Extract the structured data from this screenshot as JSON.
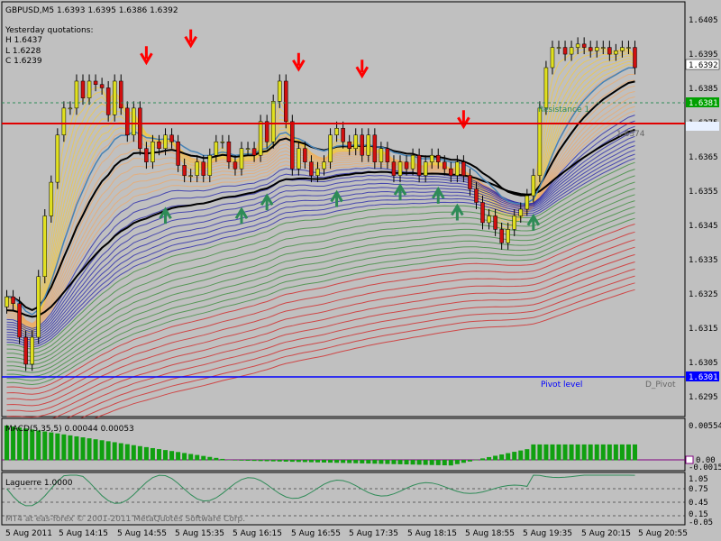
{
  "header": {
    "symbol_line": "GBPUSD,M5  1.6393 1.6395 1.6386 1.6392",
    "yesterday_title": "Yesterday quotations:",
    "high": "H 1.6437",
    "low": "L 1.6228",
    "close": "C 1.6239"
  },
  "price_axis": {
    "ticks": [
      "1.6405",
      "1.6395",
      "1.6385",
      "1.6375",
      "1.6365",
      "1.6355",
      "1.6345",
      "1.6335",
      "1.6325",
      "1.6315",
      "1.6305",
      "1.6295"
    ],
    "badges": {
      "current": "1.6392",
      "green_level": "1.6381",
      "pivot": "1.6301"
    }
  },
  "levels": {
    "resistance_label": "Resistance 1",
    "resistance_value_text": "1.6374",
    "pivot_label": "Pivot level",
    "d_pivot_label": "D_Pivot"
  },
  "time_axis": [
    "5 Aug 2011",
    "5 Aug 14:15",
    "5 Aug 14:55",
    "5 Aug 15:35",
    "5 Aug 16:15",
    "5 Aug 16:55",
    "5 Aug 17:35",
    "5 Aug 18:15",
    "5 Aug 18:55",
    "5 Aug 19:35",
    "5 Aug 20:15",
    "5 Aug 20:55"
  ],
  "macd_panel": {
    "label": "MACD(5,35,5) 0.00044 0.00053",
    "axis": [
      "0.00554",
      "0.00",
      "-0.00158"
    ]
  },
  "laguerre_panel": {
    "label": "Laguerre 1.0000",
    "axis": [
      "1.05",
      "0.75",
      "0.45",
      "0.15",
      "-0.05"
    ]
  },
  "watermark": "MT4 at eas-forex © 2001-2011 MetaQuotes Software Corp.",
  "colors": {
    "background": "#c0c0c0",
    "bull_candle": "#e0e020",
    "bear_candle": "#d01010",
    "sell_arrow": "#ff0000",
    "buy_arrow": "#2e8b57",
    "resistance_line": "#e00000",
    "pivot_line": "#0000ff",
    "macd_hist": "#10a010",
    "laguerre_line": "#2e8b57"
  },
  "chart_data": {
    "type": "candlestick",
    "title": "GBPUSD,M5",
    "ylim": [
      1.6289,
      1.6411
    ],
    "y_ticks": [
      1.6405,
      1.6395,
      1.6385,
      1.6375,
      1.6365,
      1.6355,
      1.6345,
      1.6335,
      1.6325,
      1.6315,
      1.6305,
      1.6295
    ],
    "x_labels": [
      "5 Aug 2011",
      "5 Aug 14:15",
      "5 Aug 14:55",
      "5 Aug 15:35",
      "5 Aug 16:15",
      "5 Aug 16:55",
      "5 Aug 17:35",
      "5 Aug 18:15",
      "5 Aug 18:55",
      "5 Aug 19:35",
      "5 Aug 20:15",
      "5 Aug 20:55"
    ],
    "last_quote": {
      "open": 1.6393,
      "high": 1.6395,
      "low": 1.6386,
      "close": 1.6392
    },
    "closes": [
      1.6324,
      1.6322,
      1.6312,
      1.6304,
      1.6312,
      1.633,
      1.6348,
      1.6358,
      1.6372,
      1.638,
      1.638,
      1.6388,
      1.6383,
      1.6388,
      1.6387,
      1.6386,
      1.6378,
      1.6388,
      1.638,
      1.6372,
      1.638,
      1.6368,
      1.6364,
      1.637,
      1.6368,
      1.6372,
      1.637,
      1.6363,
      1.636,
      1.636,
      1.6364,
      1.636,
      1.6366,
      1.637,
      1.637,
      1.6364,
      1.6362,
      1.6368,
      1.6368,
      1.6366,
      1.6376,
      1.637,
      1.6382,
      1.6388,
      1.6376,
      1.6362,
      1.6368,
      1.6364,
      1.636,
      1.6362,
      1.6364,
      1.6372,
      1.6374,
      1.637,
      1.6368,
      1.6372,
      1.6366,
      1.6372,
      1.6364,
      1.6368,
      1.6364,
      1.636,
      1.6364,
      1.6362,
      1.6366,
      1.636,
      1.6364,
      1.6366,
      1.6364,
      1.6362,
      1.636,
      1.6364,
      1.636,
      1.6356,
      1.6352,
      1.6346,
      1.6348,
      1.6344,
      1.634,
      1.6344,
      1.6348,
      1.635,
      1.6354,
      1.636,
      1.638,
      1.6392,
      1.6398,
      1.6398,
      1.6396,
      1.6398,
      1.6399,
      1.6398,
      1.6397,
      1.6398,
      1.6398,
      1.6396,
      1.6397,
      1.6398,
      1.6398,
      1.6392
    ],
    "sell_signals": [
      1.6393,
      1.6398,
      1.6391,
      1.6389,
      1.6374
    ],
    "buy_signals": [
      1.6351,
      1.6351,
      1.6355,
      1.6356,
      1.6358,
      1.6357,
      1.6352,
      1.6349
    ],
    "levels": {
      "resistance_1": 1.6374,
      "pivot": 1.6301,
      "green_dotted": 1.6381
    },
    "macd": {
      "params": "5,35,5",
      "main": 0.00044,
      "signal": 0.00053
    },
    "laguerre": {
      "value": 1.0
    }
  }
}
